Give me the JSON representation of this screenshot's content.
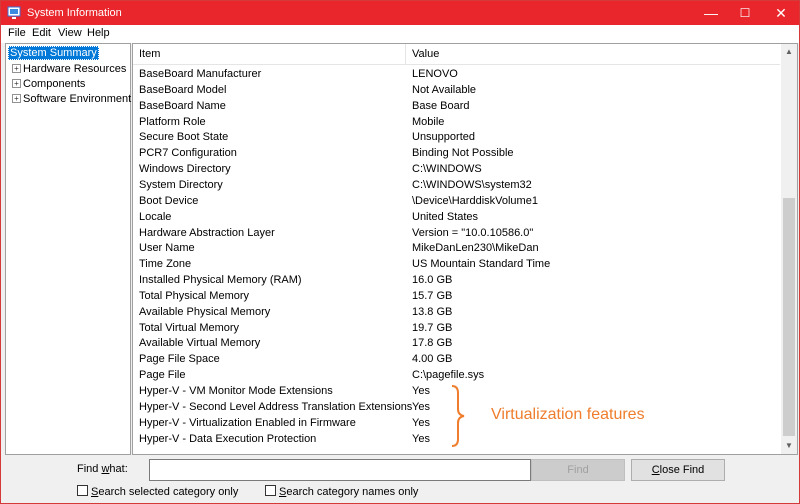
{
  "window": {
    "title": "System Information",
    "accent": "#e8262b",
    "annotation_color": "#ef7d2d"
  },
  "titlebar": {
    "minimize": "—",
    "maximize": "☐",
    "close": "✕"
  },
  "menu": [
    "File",
    "Edit",
    "View",
    "Help"
  ],
  "tree": [
    {
      "label": "System Summary",
      "selected": true,
      "expandable": false
    },
    {
      "label": "Hardware Resources",
      "expander": "+"
    },
    {
      "label": "Components",
      "expander": "+"
    },
    {
      "label": "Software Environment",
      "expander": "+"
    }
  ],
  "table": {
    "headers": [
      "Item",
      "Value"
    ],
    "rows": [
      [
        "BaseBoard Manufacturer",
        "LENOVO"
      ],
      [
        "BaseBoard Model",
        "Not Available"
      ],
      [
        "BaseBoard Name",
        "Base Board"
      ],
      [
        "Platform Role",
        "Mobile"
      ],
      [
        "Secure Boot State",
        "Unsupported"
      ],
      [
        "PCR7 Configuration",
        "Binding Not Possible"
      ],
      [
        "Windows Directory",
        "C:\\WINDOWS"
      ],
      [
        "System Directory",
        "C:\\WINDOWS\\system32"
      ],
      [
        "Boot Device",
        "\\Device\\HarddiskVolume1"
      ],
      [
        "Locale",
        "United States"
      ],
      [
        "Hardware Abstraction Layer",
        "Version = \"10.0.10586.0\""
      ],
      [
        "User Name",
        "MikeDanLen230\\MikeDan"
      ],
      [
        "Time Zone",
        "US Mountain Standard Time"
      ],
      [
        "Installed Physical Memory (RAM)",
        "16.0 GB"
      ],
      [
        "Total Physical Memory",
        "15.7 GB"
      ],
      [
        "Available Physical Memory",
        "13.8 GB"
      ],
      [
        "Total Virtual Memory",
        "19.7 GB"
      ],
      [
        "Available Virtual Memory",
        "17.8 GB"
      ],
      [
        "Page File Space",
        "4.00 GB"
      ],
      [
        "Page File",
        "C:\\pagefile.sys"
      ],
      [
        "Hyper-V - VM Monitor Mode Extensions",
        "Yes"
      ],
      [
        "Hyper-V - Second Level Address Translation Extensions",
        "Yes"
      ],
      [
        "Hyper-V - Virtualization Enabled in Firmware",
        "Yes"
      ],
      [
        "Hyper-V - Data Execution Protection",
        "Yes"
      ]
    ]
  },
  "annotation": {
    "label": "Virtualization features"
  },
  "find": {
    "label_prefix": "Find ",
    "label_accel": "w",
    "label_suffix": "hat:",
    "input_value": "",
    "find_button": "Find",
    "close_find_prefix": "",
    "close_find_accel": "C",
    "close_find_suffix": "lose Find",
    "search_selected_accel": "S",
    "search_selected_rest": "earch selected category only",
    "search_names_accel": "S",
    "search_names_rest": "earch category names only"
  }
}
